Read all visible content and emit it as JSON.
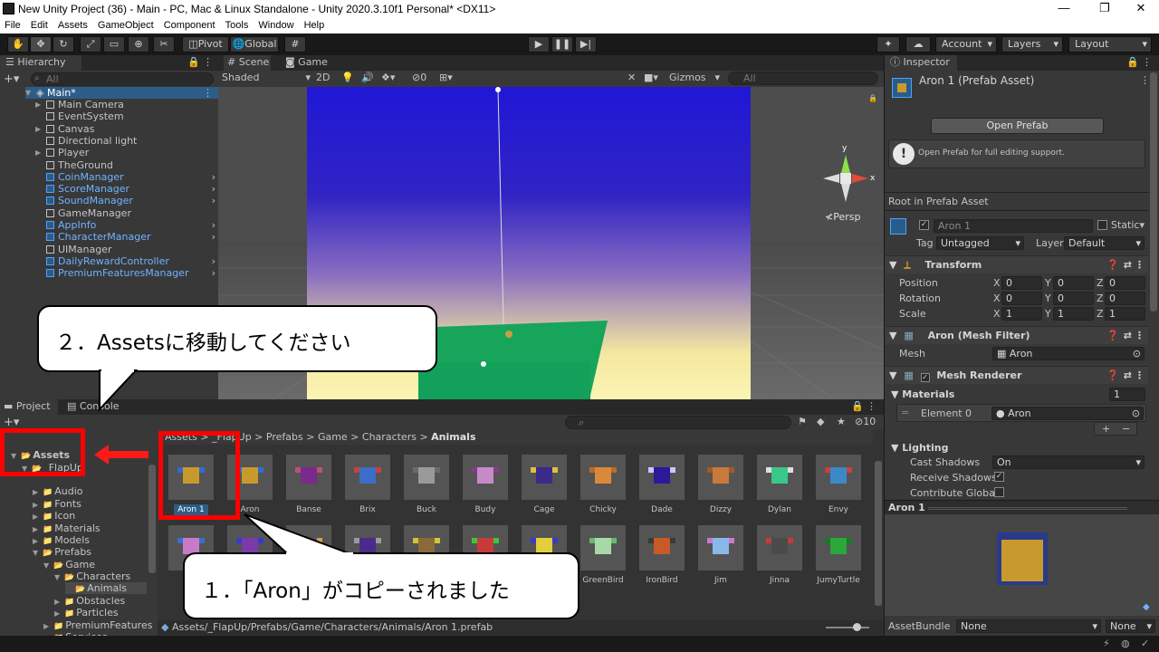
{
  "window": {
    "title": "New Unity Project (36) - Main - PC, Mac & Linux Standalone - Unity 2020.3.10f1 Personal* <DX11>",
    "controls": [
      "—",
      "❐",
      "✕"
    ]
  },
  "menu": [
    "File",
    "Edit",
    "Assets",
    "GameObject",
    "Component",
    "Tools",
    "Window",
    "Help"
  ],
  "toolbar": {
    "pivot": "Pivot",
    "global": "Global",
    "account": "Account",
    "layers": "Layers",
    "layout": "Layout"
  },
  "hierarchy": {
    "tab": "Hierarchy",
    "search_placeholder": "All",
    "scene": "Main*",
    "items": [
      {
        "label": "Main Camera",
        "prefab": false,
        "expand": true
      },
      {
        "label": "EventSystem",
        "prefab": false,
        "expand": false
      },
      {
        "label": "Canvas",
        "prefab": false,
        "expand": true
      },
      {
        "label": "Directional light",
        "prefab": false,
        "expand": false
      },
      {
        "label": "Player",
        "prefab": false,
        "expand": true
      },
      {
        "label": "TheGround",
        "prefab": false,
        "expand": false
      },
      {
        "label": "CoinManager",
        "prefab": true,
        "expand": false
      },
      {
        "label": "ScoreManager",
        "prefab": true,
        "expand": false
      },
      {
        "label": "SoundManager",
        "prefab": true,
        "expand": false
      },
      {
        "label": "GameManager",
        "prefab": false,
        "expand": false
      },
      {
        "label": "AppInfo",
        "prefab": true,
        "expand": false
      },
      {
        "label": "CharacterManager",
        "prefab": true,
        "expand": false
      },
      {
        "label": "UIManager",
        "prefab": false,
        "expand": false
      },
      {
        "label": "DailyRewardController",
        "prefab": true,
        "expand": false
      },
      {
        "label": "PremiumFeaturesManager",
        "prefab": true,
        "expand": false
      }
    ]
  },
  "scene": {
    "tab_scene": "Scene",
    "tab_game": "Game",
    "shading": "Shaded",
    "mode_2d": "2D",
    "hidden_count": "0",
    "gizmos": "Gizmos",
    "search_placeholder": "All",
    "persp": "Persp",
    "axis_y": "y",
    "axis_x": "x"
  },
  "project": {
    "tab_project": "Project",
    "tab_console": "Console",
    "breadcrumb": [
      "Assets",
      "_FlapUp",
      "Prefabs",
      "Game",
      "Characters",
      "Animals"
    ],
    "hidden_count": "10",
    "tree": [
      {
        "label": "Assets",
        "indent": 0,
        "folder": "open",
        "bold": true
      },
      {
        "label": "_FlapUp",
        "indent": 1,
        "folder": "open",
        "bold": false
      },
      {
        "label": "Audio",
        "indent": 2,
        "folder": "closed",
        "bold": false
      },
      {
        "label": "Fonts",
        "indent": 2,
        "folder": "closed",
        "bold": false
      },
      {
        "label": "Icon",
        "indent": 2,
        "folder": "closed",
        "bold": false
      },
      {
        "label": "Materials",
        "indent": 2,
        "folder": "closed",
        "bold": false
      },
      {
        "label": "Models",
        "indent": 2,
        "folder": "closed",
        "bold": false
      },
      {
        "label": "Prefabs",
        "indent": 2,
        "folder": "open",
        "bold": false
      },
      {
        "label": "Game",
        "indent": 3,
        "folder": "open",
        "bold": false
      },
      {
        "label": "Characters",
        "indent": 4,
        "folder": "open",
        "bold": false
      },
      {
        "label": "Animals",
        "indent": 5,
        "folder": "open",
        "bold": false
      },
      {
        "label": "Obstacles",
        "indent": 4,
        "folder": "closed",
        "bold": false
      },
      {
        "label": "Particles",
        "indent": 4,
        "folder": "closed",
        "bold": false
      },
      {
        "label": "PremiumFeatures",
        "indent": 3,
        "folder": "closed",
        "bold": false
      },
      {
        "label": "Services",
        "indent": 3,
        "folder": "closed",
        "bold": false
      }
    ],
    "assets_row1": [
      {
        "label": "Aron 1",
        "c1": "#c89a2e",
        "c2": "#2d6bd6"
      },
      {
        "label": "Aron",
        "c1": "#c89a2e",
        "c2": "#2d6bd6"
      },
      {
        "label": "Banse",
        "c1": "#7a2a8a",
        "c2": "#b8546e"
      },
      {
        "label": "Brix",
        "c1": "#3a6ec8",
        "c2": "#c84040"
      },
      {
        "label": "Buck",
        "c1": "#9a9a9a",
        "c2": "#6a6a6a"
      },
      {
        "label": "Budy",
        "c1": "#c78ac8",
        "c2": "#8a3a8a"
      },
      {
        "label": "Cage",
        "c1": "#3a2a8a",
        "c2": "#e0c040"
      },
      {
        "label": "Chicky",
        "c1": "#d88a3a",
        "c2": "#b86a2a"
      },
      {
        "label": "Dade",
        "c1": "#2a1a9a",
        "c2": "#c8c8ff"
      },
      {
        "label": "Dizzy",
        "c1": "#c87a3a",
        "c2": "#a05a2a"
      },
      {
        "label": "Dylan",
        "c1": "#3ac88a",
        "c2": "#e0e0e0"
      },
      {
        "label": "Envy",
        "c1": "#3a8ac8",
        "c2": "#c84040"
      }
    ],
    "assets_row2": [
      {
        "label": "",
        "c1": "#c87ac8",
        "c2": "#3a6ec8"
      },
      {
        "label": "",
        "c1": "#7a3aa8",
        "c2": "#3a3ac8"
      },
      {
        "label": "",
        "c1": "#7a3a8a",
        "c2": "#c8a83a"
      },
      {
        "label": "",
        "c1": "#4a2a8a",
        "c2": "#9a9a9a"
      },
      {
        "label": "",
        "c1": "#8a6a3a",
        "c2": "#c8c83a"
      },
      {
        "label": "",
        "c1": "#c83a3a",
        "c2": "#3ac83a"
      },
      {
        "label": "",
        "c1": "#e0d03a",
        "c2": "#3a3ac8"
      },
      {
        "label": "GreenBird",
        "c1": "#a8d8a8",
        "c2": "#6ab86a"
      },
      {
        "label": "IronBird",
        "c1": "#c85a2a",
        "c2": "#3a3a3a"
      },
      {
        "label": "Jim",
        "c1": "#8ab8e8",
        "c2": "#c87ac8"
      },
      {
        "label": "Jinna",
        "c1": "#4a4a4a",
        "c2": "#c83a3a"
      },
      {
        "label": "JumyTurtle",
        "c1": "#2aa83a",
        "c2": "#1a7a2a"
      }
    ],
    "status_path": "Assets/_FlapUp/Prefabs/Game/Characters/Animals/Aron 1.prefab"
  },
  "inspector": {
    "tab": "Inspector",
    "asset_title": "Aron 1 (Prefab Asset)",
    "open_prefab": "Open Prefab",
    "info": "Open Prefab for full editing support.",
    "root_label": "Root in Prefab Asset",
    "object_name": "Aron 1",
    "static": "Static",
    "tag_label": "Tag",
    "tag_value": "Untagged",
    "layer_label": "Layer",
    "layer_value": "Default",
    "transform": "Transform",
    "position": "Position",
    "rotation": "Rotation",
    "scale": "Scale",
    "pos": [
      "0",
      "0",
      "0"
    ],
    "rot": [
      "0",
      "0",
      "0"
    ],
    "scl": [
      "1",
      "1",
      "1"
    ],
    "axis": [
      "X",
      "Y",
      "Z"
    ],
    "mesh_filter": "Aron (Mesh Filter)",
    "mesh_label": "Mesh",
    "mesh_value": "Aron",
    "mesh_renderer": "Mesh Renderer",
    "materials": "Materials",
    "materials_count": "1",
    "element0": "Element 0",
    "element0_value": "Aron",
    "lighting": "Lighting",
    "cast_shadows": "Cast Shadows",
    "cast_shadows_value": "On",
    "receive_shadows": "Receive Shadows",
    "contribute_gi": "Contribute Global I",
    "preview_title": "Aron 1",
    "asset_bundle": "AssetBundle",
    "asset_bundle_value": "None",
    "asset_bundle_variant": "None"
  },
  "callouts": {
    "step2": "２．Assetsに移動してください",
    "step1": "１．「Aron」がコピーされました"
  },
  "colors": {
    "accent": "#2c5d87",
    "highlight_red": "#ff0000",
    "prefab_blue": "#6fb3ff"
  }
}
